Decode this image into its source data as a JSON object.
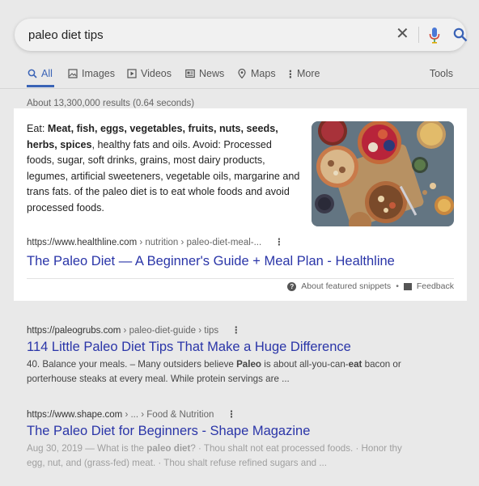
{
  "search": {
    "query": "paleo diet tips"
  },
  "tabs": [
    {
      "label": "All",
      "icon": "search-icon"
    },
    {
      "label": "Images",
      "icon": "image-icon"
    },
    {
      "label": "Videos",
      "icon": "video-icon"
    },
    {
      "label": "News",
      "icon": "news-icon"
    },
    {
      "label": "Maps",
      "icon": "map-pin-icon"
    },
    {
      "label": "More",
      "icon": "more-vert-icon"
    }
  ],
  "tools_label": "Tools",
  "result_stats": "About 13,300,000 results (0.64 seconds)",
  "featured_snippet": {
    "text_intro": "Eat: ",
    "text_bold": "Meat, fish, eggs, vegetables, fruits, nuts, seeds, herbs, spices",
    "text_rest": ", healthy fats and oils. Avoid: Processed foods, sugar, soft drinks, grains, most dairy products, legumes, artificial sweeteners, vegetable oils, margarine and trans fats. of the paleo diet is to eat whole foods and avoid processed foods.",
    "url_domain": "https://www.healthline.com",
    "url_path": " › nutrition › paleo-diet-meal-...",
    "title": "The Paleo Diet — A Beginner's Guide + Meal Plan - Healthline",
    "about_label": "About featured snippets",
    "feedback_label": "Feedback"
  },
  "results": [
    {
      "url_domain": "https://paleogrubs.com",
      "url_path": " › paleo-diet-guide › tips",
      "title": "114 Little Paleo Diet Tips That Make a Huge Difference",
      "desc_1": "40. Balance your meals. – Many outsiders believe ",
      "desc_b1": "Paleo",
      "desc_2": " is about all-you-can-",
      "desc_b2": "eat",
      "desc_3": " bacon or porterhouse steaks at every meal. While protein servings are ..."
    },
    {
      "url_domain": "https://www.shape.com",
      "url_path": " › ... › Food & Nutrition",
      "title": "The Paleo Diet for Beginners - Shape Magazine",
      "desc_1": "Aug 30, 2019 — What is the ",
      "desc_b1": "paleo diet",
      "desc_2": "? · Thou shalt not eat processed foods. · Honor thy egg, nut, and (grass-fed) meat. · Thou shalt refuse refined sugars and ..."
    }
  ],
  "colors": {
    "link": "#2a35a8",
    "accent": "#3a63b6",
    "dim_background": "#e9e9e9",
    "snippet_background": "#ffffff"
  }
}
